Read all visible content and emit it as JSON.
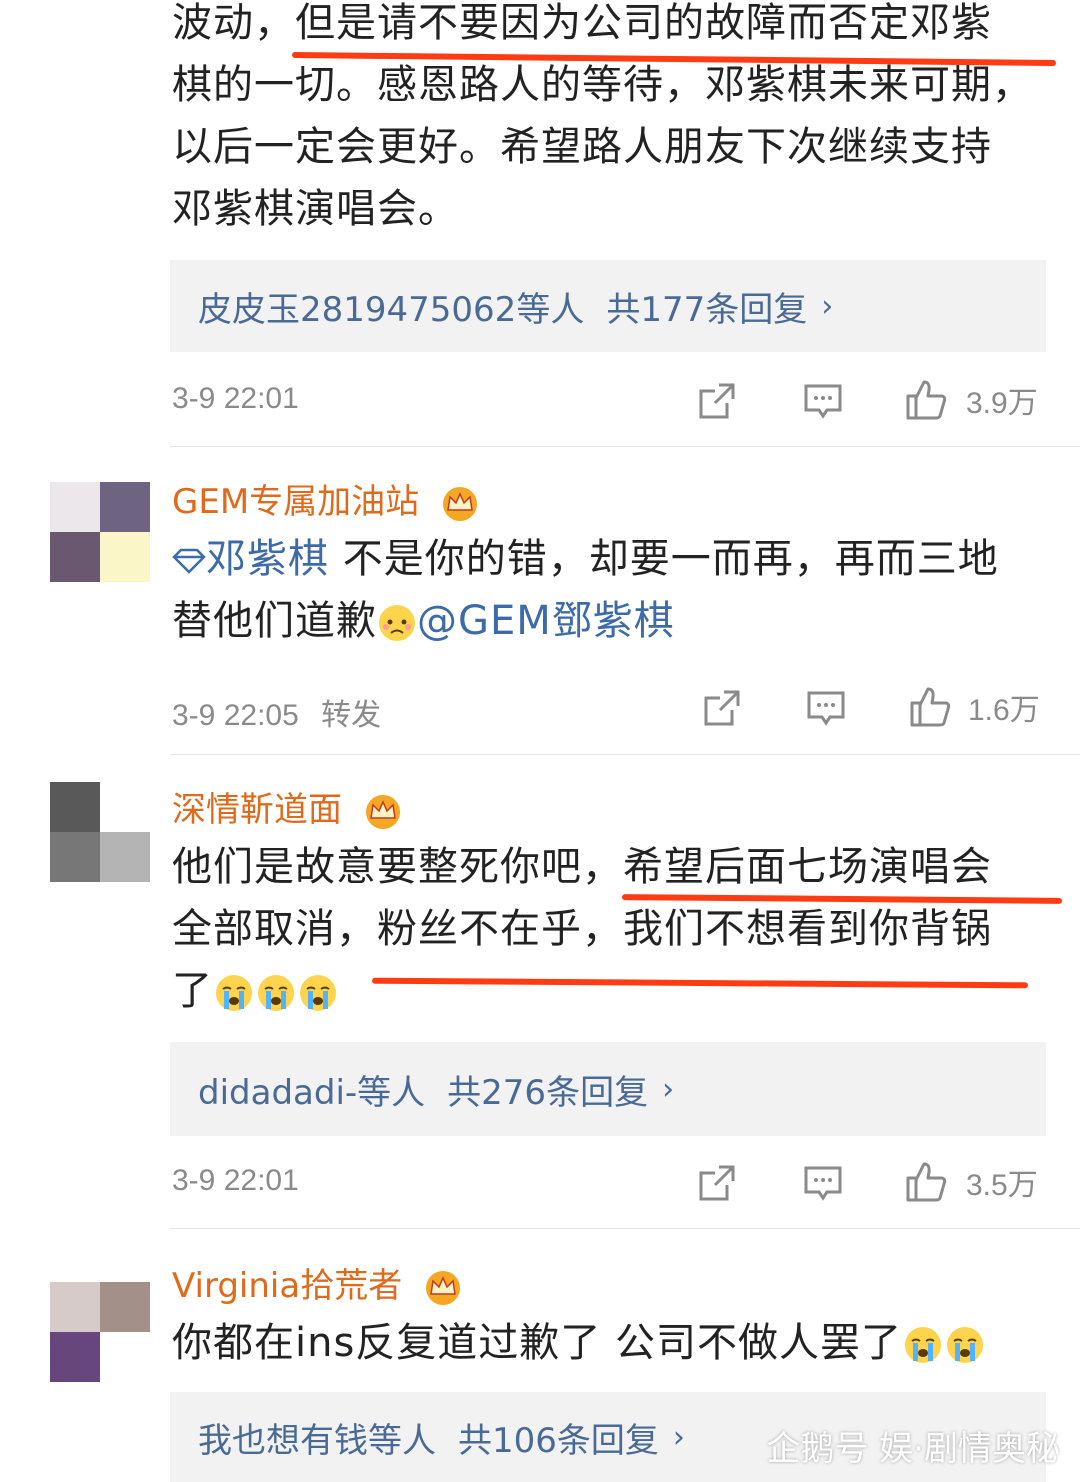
{
  "comment1": {
    "lines": [
      "波动，但是请不要因为公司的故障而否定邓紫",
      "棋的一切。感恩路人的等待，邓紫棋未来可期，",
      "以后一定会更好。希望路人朋友下次继续支持",
      "邓紫棋演唱会。"
    ],
    "reply": {
      "names": "皮皮玉2819475062等人",
      "count": "共177条回复",
      "chevron": "›"
    },
    "time": "3-9 22:01",
    "likes": "3.9万"
  },
  "comment2": {
    "username": "GEM专属加油站",
    "topic": "邓紫棋",
    "line1_rest": " 不是你的错，却要一而再，再而三地",
    "line2_text": "替他们道歉",
    "mention": "@GEM鄧紫棋",
    "time": "3-9 22:05",
    "repost": "转发",
    "likes": "1.6万"
  },
  "comment3": {
    "username": "深情靳道面",
    "lines": [
      "他们是故意要整死你吧，希望后面七场演唱会",
      "全部取消，粉丝不在乎，我们不想看到你背锅",
      "了"
    ],
    "reply": {
      "names": "didadadi-等人",
      "count": "共276条回复",
      "chevron": "›"
    },
    "time": "3-9 22:01",
    "likes": "3.5万"
  },
  "comment4": {
    "username": "Virginia拾荒者",
    "line": "你都在ins反复道过歉了 公司不做人罢了",
    "reply": {
      "names": "我也想有钱等人",
      "count": "共106条回复",
      "chevron": "›"
    }
  },
  "watermark": "企鹅号 娱·剧情奥秘",
  "colors": {
    "username": "#e06a1b",
    "link": "#4a6a96",
    "highlight": "#ff3b14",
    "meta": "#8a8a8a"
  }
}
